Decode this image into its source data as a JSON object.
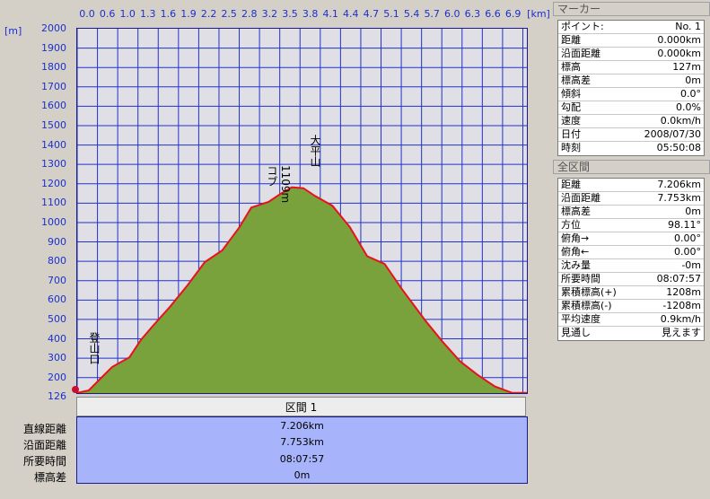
{
  "x_axis": {
    "unit": "[km]",
    "ticks": [
      "0.0",
      "0.6",
      "1.0",
      "1.3",
      "1.6",
      "1.9",
      "2.2",
      "2.5",
      "2.8",
      "3.2",
      "3.5",
      "3.8",
      "4.1",
      "4.4",
      "4.7",
      "5.1",
      "5.4",
      "5.7",
      "6.0",
      "6.3",
      "6.6",
      "6.9"
    ]
  },
  "y_axis": {
    "unit": "[m]",
    "ticks": [
      "2000",
      "1900",
      "1800",
      "1700",
      "1600",
      "1500",
      "1400",
      "1300",
      "1200",
      "1100",
      "1000",
      "900",
      "800",
      "700",
      "600",
      "500",
      "400",
      "300",
      "200",
      "126"
    ]
  },
  "annotations": {
    "trailhead": "登山口",
    "kobu_height": "1109m",
    "kobu_name": "コブ",
    "summit": "大平山"
  },
  "colors": {
    "fill": "#7aa23c",
    "line": "#e8121b",
    "grid": "#2233cc",
    "plot_bg": "#dfdfe5",
    "summary_bg": "#a7b3fa"
  },
  "chart_data": {
    "type": "area",
    "xlabel": "[km]",
    "ylabel": "[m]",
    "xlim": [
      0,
      7.753
    ],
    "ylim": [
      126,
      2000
    ],
    "grid": true,
    "x": [
      0.0,
      0.2,
      0.4,
      0.6,
      0.9,
      1.1,
      1.3,
      1.6,
      1.9,
      2.2,
      2.5,
      2.8,
      3.0,
      3.1,
      3.3,
      3.5,
      3.7,
      3.9,
      4.1,
      4.4,
      4.7,
      5.0,
      5.3,
      5.6,
      6.0,
      6.3,
      6.6,
      6.9,
      7.2,
      7.5,
      7.753
    ],
    "values": [
      127,
      140,
      200,
      260,
      310,
      400,
      470,
      570,
      680,
      800,
      860,
      980,
      1080,
      1090,
      1109,
      1150,
      1185,
      1180,
      1140,
      1090,
      980,
      830,
      790,
      660,
      500,
      390,
      290,
      220,
      160,
      127,
      127
    ]
  },
  "section": {
    "label": "区間 1",
    "rows": [
      {
        "label": "直線距離",
        "value": "7.206km"
      },
      {
        "label": "沿面距離",
        "value": "7.753km"
      },
      {
        "label": "所要時間",
        "value": "08:07:57"
      },
      {
        "label": "標高差",
        "value": "0m"
      }
    ]
  },
  "marker_panel": {
    "title": "マーカー",
    "rows": [
      {
        "label": "ポイント:",
        "value": "No. 1"
      },
      {
        "label": "距離",
        "value": "0.000km"
      },
      {
        "label": "沿面距離",
        "value": "0.000km"
      },
      {
        "label": "標高",
        "value": "127m"
      },
      {
        "label": "標高差",
        "value": "0m"
      },
      {
        "label": "傾斜",
        "value": "0.0°"
      },
      {
        "label": "勾配",
        "value": "0.0%"
      },
      {
        "label": "速度",
        "value": "0.0km/h"
      },
      {
        "label": "日付",
        "value": "2008/07/30"
      },
      {
        "label": "時刻",
        "value": "05:50:08"
      }
    ]
  },
  "total_panel": {
    "title": "全区間",
    "rows": [
      {
        "label": "距離",
        "value": "7.206km"
      },
      {
        "label": "沿面距離",
        "value": "7.753km"
      },
      {
        "label": "標高差",
        "value": "0m"
      },
      {
        "label": "方位",
        "value": "98.11°"
      },
      {
        "label": "俯角→",
        "value": "0.00°"
      },
      {
        "label": "俯角←",
        "value": "0.00°"
      },
      {
        "label": "沈み量",
        "value": "-0m"
      },
      {
        "label": "所要時間",
        "value": "08:07:57"
      },
      {
        "label": "累積標高(+)",
        "value": "1208m"
      },
      {
        "label": "累積標高(-)",
        "value": "-1208m"
      },
      {
        "label": "平均速度",
        "value": "0.9km/h"
      },
      {
        "label": "見通し",
        "value": "見えます"
      }
    ]
  }
}
